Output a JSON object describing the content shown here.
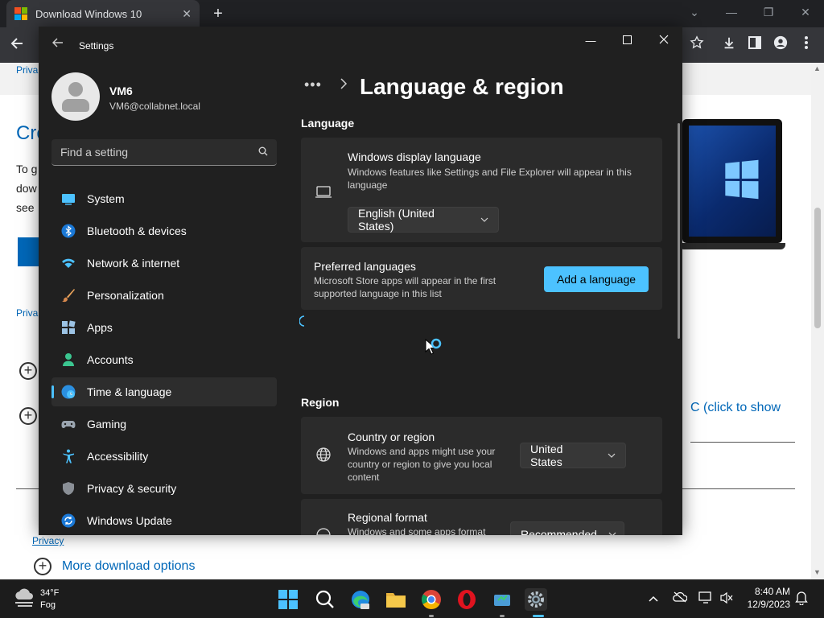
{
  "browser": {
    "tab_title": "Download Windows 10",
    "tab_close": "✕",
    "new_tab": "+",
    "window_controls": [
      "⌄",
      "—",
      "❐",
      "✕"
    ]
  },
  "webpage": {
    "top_link_1": "Priva",
    "heading_fragment": "Cre",
    "body_line_1": "To g",
    "body_line_2": "dow",
    "body_line_3": "see",
    "mid_link": "Priva",
    "click_to_show": "C (click to show",
    "privacy_link": "Privacy",
    "more_options": "More download options"
  },
  "settings": {
    "window_title": "Settings",
    "user": {
      "name": "VM6",
      "email": "VM6@collabnet.local"
    },
    "search": {
      "placeholder": "Find a setting"
    },
    "nav": [
      {
        "label": "System",
        "icon": "system-icon",
        "active": false
      },
      {
        "label": "Bluetooth & devices",
        "icon": "bluetooth-icon",
        "active": false
      },
      {
        "label": "Network & internet",
        "icon": "network-icon",
        "active": false
      },
      {
        "label": "Personalization",
        "icon": "personalization-icon",
        "active": false
      },
      {
        "label": "Apps",
        "icon": "apps-icon",
        "active": false
      },
      {
        "label": "Accounts",
        "icon": "accounts-icon",
        "active": false
      },
      {
        "label": "Time & language",
        "icon": "time-language-icon",
        "active": true
      },
      {
        "label": "Gaming",
        "icon": "gaming-icon",
        "active": false
      },
      {
        "label": "Accessibility",
        "icon": "accessibility-icon",
        "active": false
      },
      {
        "label": "Privacy & security",
        "icon": "privacy-shield-icon",
        "active": false
      },
      {
        "label": "Windows Update",
        "icon": "windows-update-icon",
        "active": false
      }
    ],
    "breadcrumb_ellipsis": "•••",
    "page_title": "Language & region",
    "language": {
      "heading": "Language",
      "display_language": {
        "title": "Windows display language",
        "description": "Windows features like Settings and File Explorer will appear in this language",
        "value": "English (United States)"
      },
      "preferred": {
        "title": "Preferred languages",
        "description": "Microsoft Store apps will appear in the first supported language in this list",
        "button": "Add a language"
      }
    },
    "region": {
      "heading": "Region",
      "country": {
        "title": "Country or region",
        "description": "Windows and apps might use your country or region to give you local content",
        "value": "United States"
      },
      "format": {
        "title": "Regional format",
        "description": "Windows and some apps format",
        "value": "Recommended"
      }
    }
  },
  "taskbar": {
    "weather_temp": "34°F",
    "weather_condition": "Fog",
    "time": "8:40 AM",
    "date": "12/9/2023"
  },
  "colors": {
    "accent": "#4cc2ff",
    "settings_bg": "#202020",
    "card_bg": "#2b2b2b",
    "chrome_bg": "#35363a",
    "taskbar_bg": "#1c1c1c",
    "web_link": "#0067b8"
  }
}
